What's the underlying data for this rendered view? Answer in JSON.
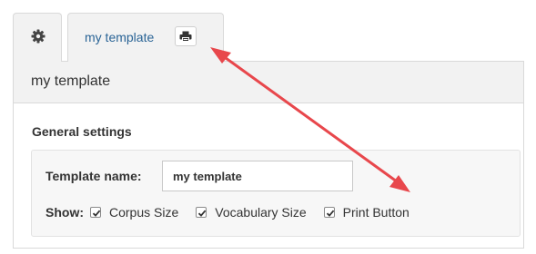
{
  "tabs": {
    "settings_icon": "gear-icon",
    "template_label": "my template",
    "print_icon": "print-icon"
  },
  "panel": {
    "title": "my template",
    "section_heading": "General settings",
    "template_name_label": "Template name:",
    "template_name_value": "my template",
    "show_label": "Show:",
    "options": [
      {
        "label": "Corpus Size",
        "checked": true
      },
      {
        "label": "Vocabulary Size",
        "checked": true
      },
      {
        "label": "Print Button",
        "checked": true
      }
    ]
  },
  "colors": {
    "tab_link": "#2a6496",
    "annotation_arrow": "#e8474c",
    "panel_header_bg": "#f2f2f2"
  }
}
